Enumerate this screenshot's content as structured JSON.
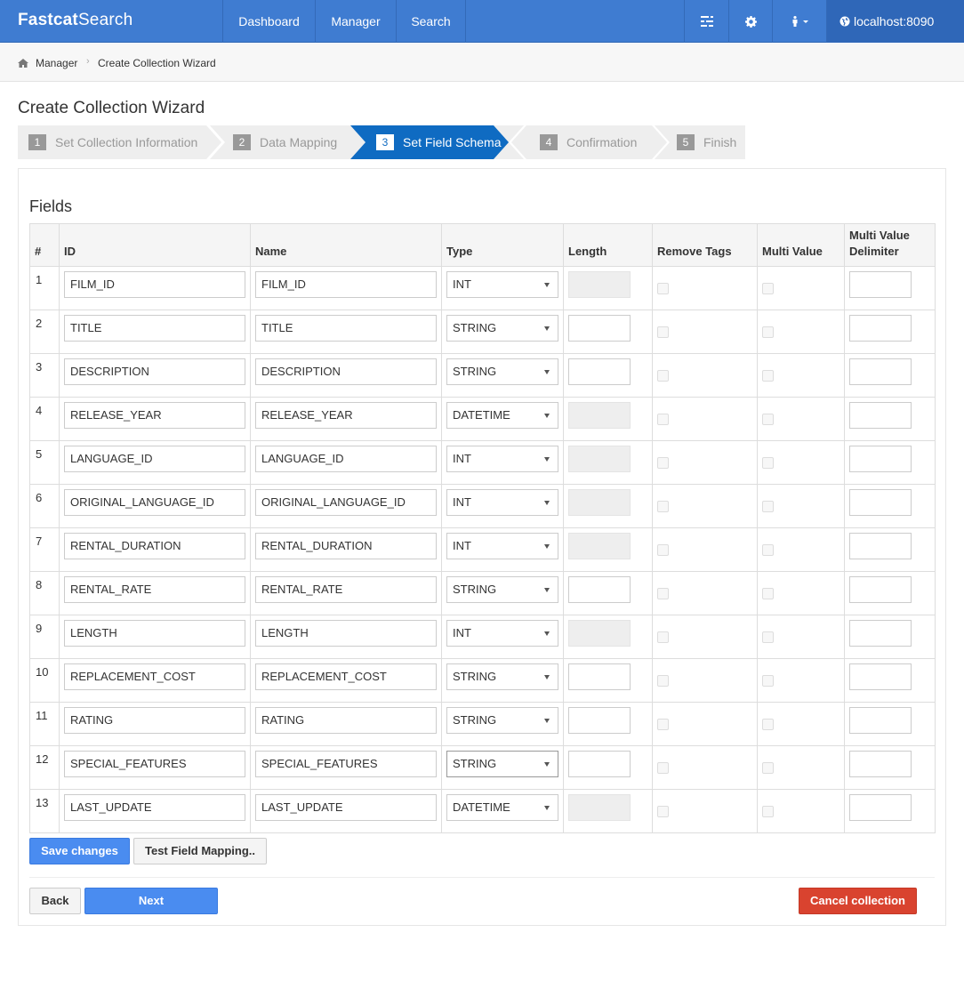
{
  "navbar": {
    "brand_bold": "Fastcat",
    "brand_thin": "Search",
    "links": [
      "Dashboard",
      "Manager",
      "Search"
    ],
    "host": "localhost:8090",
    "icons": [
      "tasks-icon",
      "gear-icon",
      "user-icon"
    ]
  },
  "breadcrumb": {
    "home": "Manager",
    "current": "Create Collection Wizard"
  },
  "page": {
    "title": "Create Collection Wizard"
  },
  "wizard": {
    "steps": [
      {
        "num": "1",
        "label": "Set Collection Information"
      },
      {
        "num": "2",
        "label": "Data Mapping"
      },
      {
        "num": "3",
        "label": "Set Field Schema"
      },
      {
        "num": "4",
        "label": "Confirmation"
      },
      {
        "num": "5",
        "label": "Finish"
      }
    ],
    "active_step": 3
  },
  "fields": {
    "title": "Fields",
    "headers": {
      "num": "#",
      "id": "ID",
      "name": "Name",
      "type": "Type",
      "length": "Length",
      "remove_tags": "Remove Tags",
      "multi_value": "Multi Value",
      "mvd_line1": "Multi Value",
      "mvd_line2": "Delimiter"
    },
    "rows": [
      {
        "num": "1",
        "id": "FILM_ID",
        "name": "FILM_ID",
        "type": "INT",
        "length_enabled": false
      },
      {
        "num": "2",
        "id": "TITLE",
        "name": "TITLE",
        "type": "STRING",
        "length_enabled": true
      },
      {
        "num": "3",
        "id": "DESCRIPTION",
        "name": "DESCRIPTION",
        "type": "STRING",
        "length_enabled": true
      },
      {
        "num": "4",
        "id": "RELEASE_YEAR",
        "name": "RELEASE_YEAR",
        "type": "DATETIME",
        "length_enabled": false
      },
      {
        "num": "5",
        "id": "LANGUAGE_ID",
        "name": "LANGUAGE_ID",
        "type": "INT",
        "length_enabled": false
      },
      {
        "num": "6",
        "id": "ORIGINAL_LANGUAGE_ID",
        "name": "ORIGINAL_LANGUAGE_ID",
        "type": "INT",
        "length_enabled": false
      },
      {
        "num": "7",
        "id": "RENTAL_DURATION",
        "name": "RENTAL_DURATION",
        "type": "INT",
        "length_enabled": false
      },
      {
        "num": "8",
        "id": "RENTAL_RATE",
        "name": "RENTAL_RATE",
        "type": "STRING",
        "length_enabled": true
      },
      {
        "num": "9",
        "id": "LENGTH",
        "name": "LENGTH",
        "type": "INT",
        "length_enabled": false
      },
      {
        "num": "10",
        "id": "REPLACEMENT_COST",
        "name": "REPLACEMENT_COST",
        "type": "STRING",
        "length_enabled": true
      },
      {
        "num": "11",
        "id": "RATING",
        "name": "RATING",
        "type": "STRING",
        "length_enabled": true
      },
      {
        "num": "12",
        "id": "SPECIAL_FEATURES",
        "name": "SPECIAL_FEATURES",
        "type": "STRING",
        "length_enabled": true,
        "focused": true
      },
      {
        "num": "13",
        "id": "LAST_UPDATE",
        "name": "LAST_UPDATE",
        "type": "DATETIME",
        "length_enabled": false
      }
    ]
  },
  "buttons": {
    "save": "Save changes",
    "test": "Test Field Mapping..",
    "back": "Back",
    "next": "Next",
    "cancel": "Cancel collection"
  },
  "colors": {
    "navbar": "#3f7cd1",
    "wizard_active": "#0f6bc2",
    "primary_button": "#4a8cf0",
    "danger_button": "#d9432f"
  }
}
